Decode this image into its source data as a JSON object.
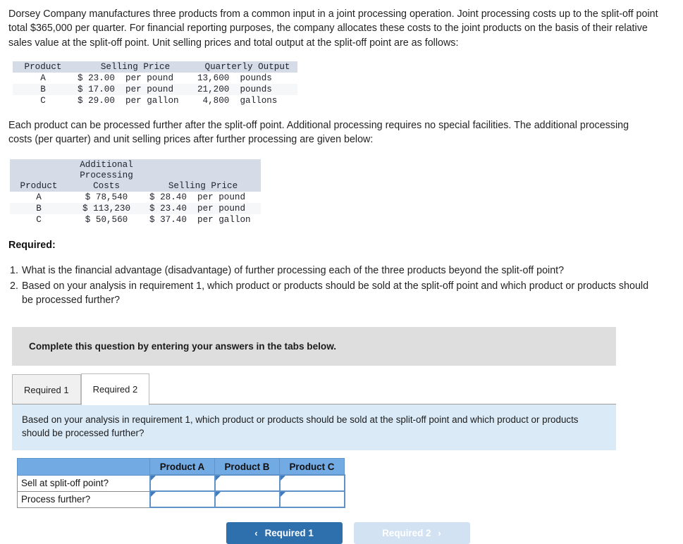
{
  "intro": {
    "paragraph_1": "Dorsey Company manufactures three products from a common input in a joint processing operation. Joint processing costs up to the split-off point total $365,000 per quarter. For financial reporting purposes, the company allocates these costs to the joint products on the basis of their relative sales value at the split-off point. Unit selling prices and total output at the split-off point are as follows:",
    "paragraph_2": "Each product can be processed further after the split-off point. Additional processing requires no special facilities. The additional processing costs (per quarter) and unit selling prices after further processing are given below:"
  },
  "table_splitoff": {
    "headers": [
      "Product",
      "Selling Price",
      "Quarterly Output"
    ],
    "rows": [
      {
        "product": "A",
        "price": "$ 23.00  per pound",
        "output": "13,600  pounds"
      },
      {
        "product": "B",
        "price": "$ 17.00  per pound",
        "output": "21,200  pounds"
      },
      {
        "product": "C",
        "price": "$ 29.00  per gallon",
        "output": " 4,800  gallons"
      }
    ]
  },
  "table_further": {
    "headers": {
      "product": "Product",
      "costs_line1": "Additional",
      "costs_line2": "Processing",
      "costs_line3": "Costs",
      "selling_price": "Selling Price"
    },
    "rows": [
      {
        "product": "A",
        "cost": "$ 78,540",
        "price": "$ 28.40  per pound"
      },
      {
        "product": "B",
        "cost": "$ 113,230",
        "price": "$ 23.40  per pound"
      },
      {
        "product": "C",
        "cost": "$ 50,560",
        "price": "$ 37.40  per gallon"
      }
    ]
  },
  "required": {
    "heading": "Required:",
    "items": [
      {
        "num": "1.",
        "text": "What is the financial advantage (disadvantage) of further processing each of the three products beyond the split-off point?"
      },
      {
        "num": "2.",
        "text": "Based on your analysis in requirement 1, which product or products should be sold at the split-off point and which product or products should be processed further?"
      }
    ]
  },
  "instruction_bar": {
    "text": "Complete this question by entering your answers in the tabs below."
  },
  "tabs": [
    {
      "label": "Required 1",
      "active": false
    },
    {
      "label": "Required 2",
      "active": true
    }
  ],
  "question_panel": {
    "text": "Based on your analysis in requirement 1, which product or products should be sold at the split-off point and which product or products should be processed further?"
  },
  "answer_grid": {
    "corner_label": "",
    "columns": [
      "Product A",
      "Product B",
      "Product C"
    ],
    "rows": [
      {
        "label": "Sell at split-off point?",
        "values": [
          "",
          "",
          ""
        ]
      },
      {
        "label": "Process further?",
        "values": [
          "",
          "",
          ""
        ]
      }
    ]
  },
  "navigation": {
    "prev": {
      "label": "Required 1",
      "icon": "chevron-left-icon",
      "glyph": "‹",
      "enabled": true,
      "color": "#2e6fad"
    },
    "next": {
      "label": "Required 2",
      "icon": "chevron-right-icon",
      "glyph": "›",
      "enabled": false,
      "color": "#d3e2f2"
    }
  }
}
